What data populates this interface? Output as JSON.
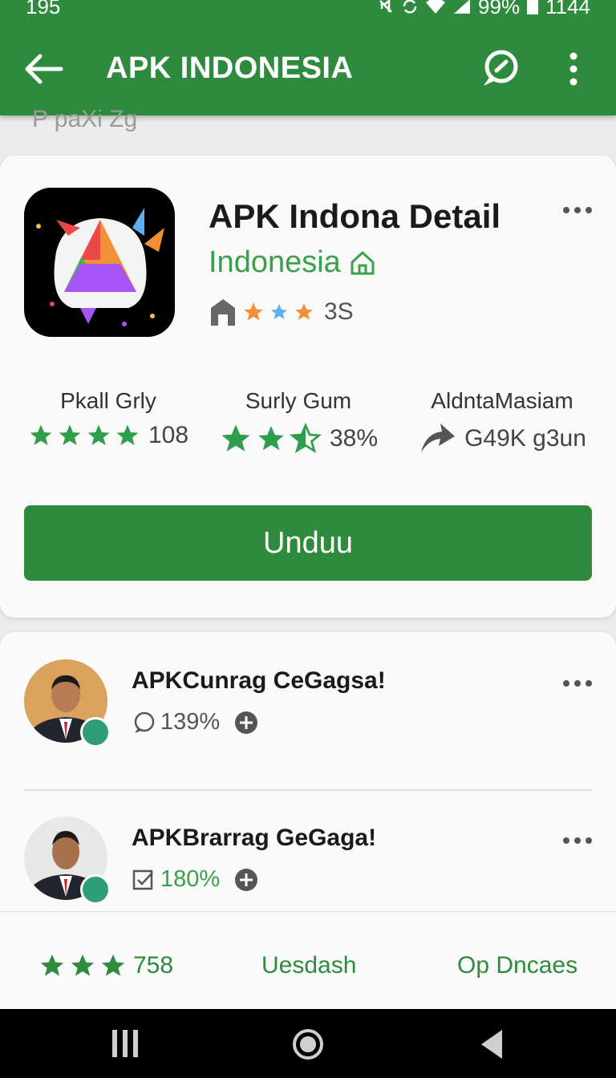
{
  "status": {
    "time": "195",
    "battery": "99%",
    "clock": "1144"
  },
  "appbar": {
    "title": "APK INDONESIA"
  },
  "faded_text": "P paXi Zg",
  "detail": {
    "title": "APK Indona Detail",
    "subtitle": "Indonesia",
    "rating_count": "3S",
    "stats": [
      {
        "label": "Pkall Grly",
        "value": "108",
        "stars": 4
      },
      {
        "label": "Surly Gum",
        "value": "38%",
        "stars": 2.5
      },
      {
        "label": "AldntaMasiam",
        "value": "G49K g3un"
      }
    ],
    "download_label": "Unduu"
  },
  "list": [
    {
      "name": "APKCunrag CeGagsa!",
      "meta": "139%"
    },
    {
      "name": "APKBrarrag GeGaga!",
      "meta": "180%"
    }
  ],
  "bottom": {
    "rating": "758",
    "link1": "Uesdash",
    "link2": "Op Dncaes"
  },
  "colors": {
    "primary": "#2e8b3d",
    "accent": "#3aa04a",
    "badge": "#2e9e7a"
  },
  "icons": [
    "back-arrow-icon",
    "chat-icon",
    "more-vert-icon",
    "star-icon",
    "share-arrow-icon",
    "recents-icon",
    "home-icon",
    "back-triangle-icon"
  ]
}
